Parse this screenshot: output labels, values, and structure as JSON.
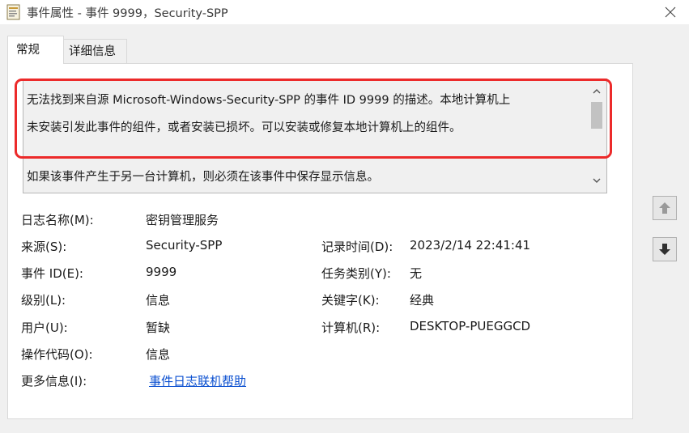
{
  "window": {
    "title": "事件属性 - 事件 9999，Security-SPP",
    "icon": "event-properties-icon",
    "close_icon": "close-icon"
  },
  "tabs": [
    {
      "label": "常规",
      "selected": true
    },
    {
      "label": "详细信息",
      "selected": false
    }
  ],
  "description": {
    "line1": "无法找到来自源 Microsoft-Windows-Security-SPP 的事件 ID 9999 的描述。本地计算机上",
    "line2": "未安装引发此事件的组件，或者安装已损坏。可以安装或修复本地计算机上的组件。",
    "line3": "如果该事件产生于另一台计算机，则必须在该事件中保存显示信息。"
  },
  "fields": {
    "log_name": {
      "label": "日志名称(M):",
      "value": "密钥管理服务"
    },
    "source": {
      "label": "来源(S):",
      "value": "Security-SPP"
    },
    "logged": {
      "label": "记录时间(D):",
      "value": "2023/2/14 22:41:41"
    },
    "event_id": {
      "label": "事件 ID(E):",
      "value": "9999"
    },
    "task_category": {
      "label": "任务类别(Y):",
      "value": "无"
    },
    "level": {
      "label": "级别(L):",
      "value": "信息"
    },
    "keywords": {
      "label": "关键字(K):",
      "value": "经典"
    },
    "user": {
      "label": "用户(U):",
      "value": "暂缺"
    },
    "computer": {
      "label": "计算机(R):",
      "value": "DESKTOP-PUEGGCD"
    },
    "opcode": {
      "label": "操作代码(O):",
      "value": "信息"
    },
    "more_info": {
      "label": "更多信息(I):",
      "link": "事件日志联机帮助"
    }
  },
  "colors": {
    "highlight": "#ec2a2a",
    "link": "#0a4fd0"
  }
}
